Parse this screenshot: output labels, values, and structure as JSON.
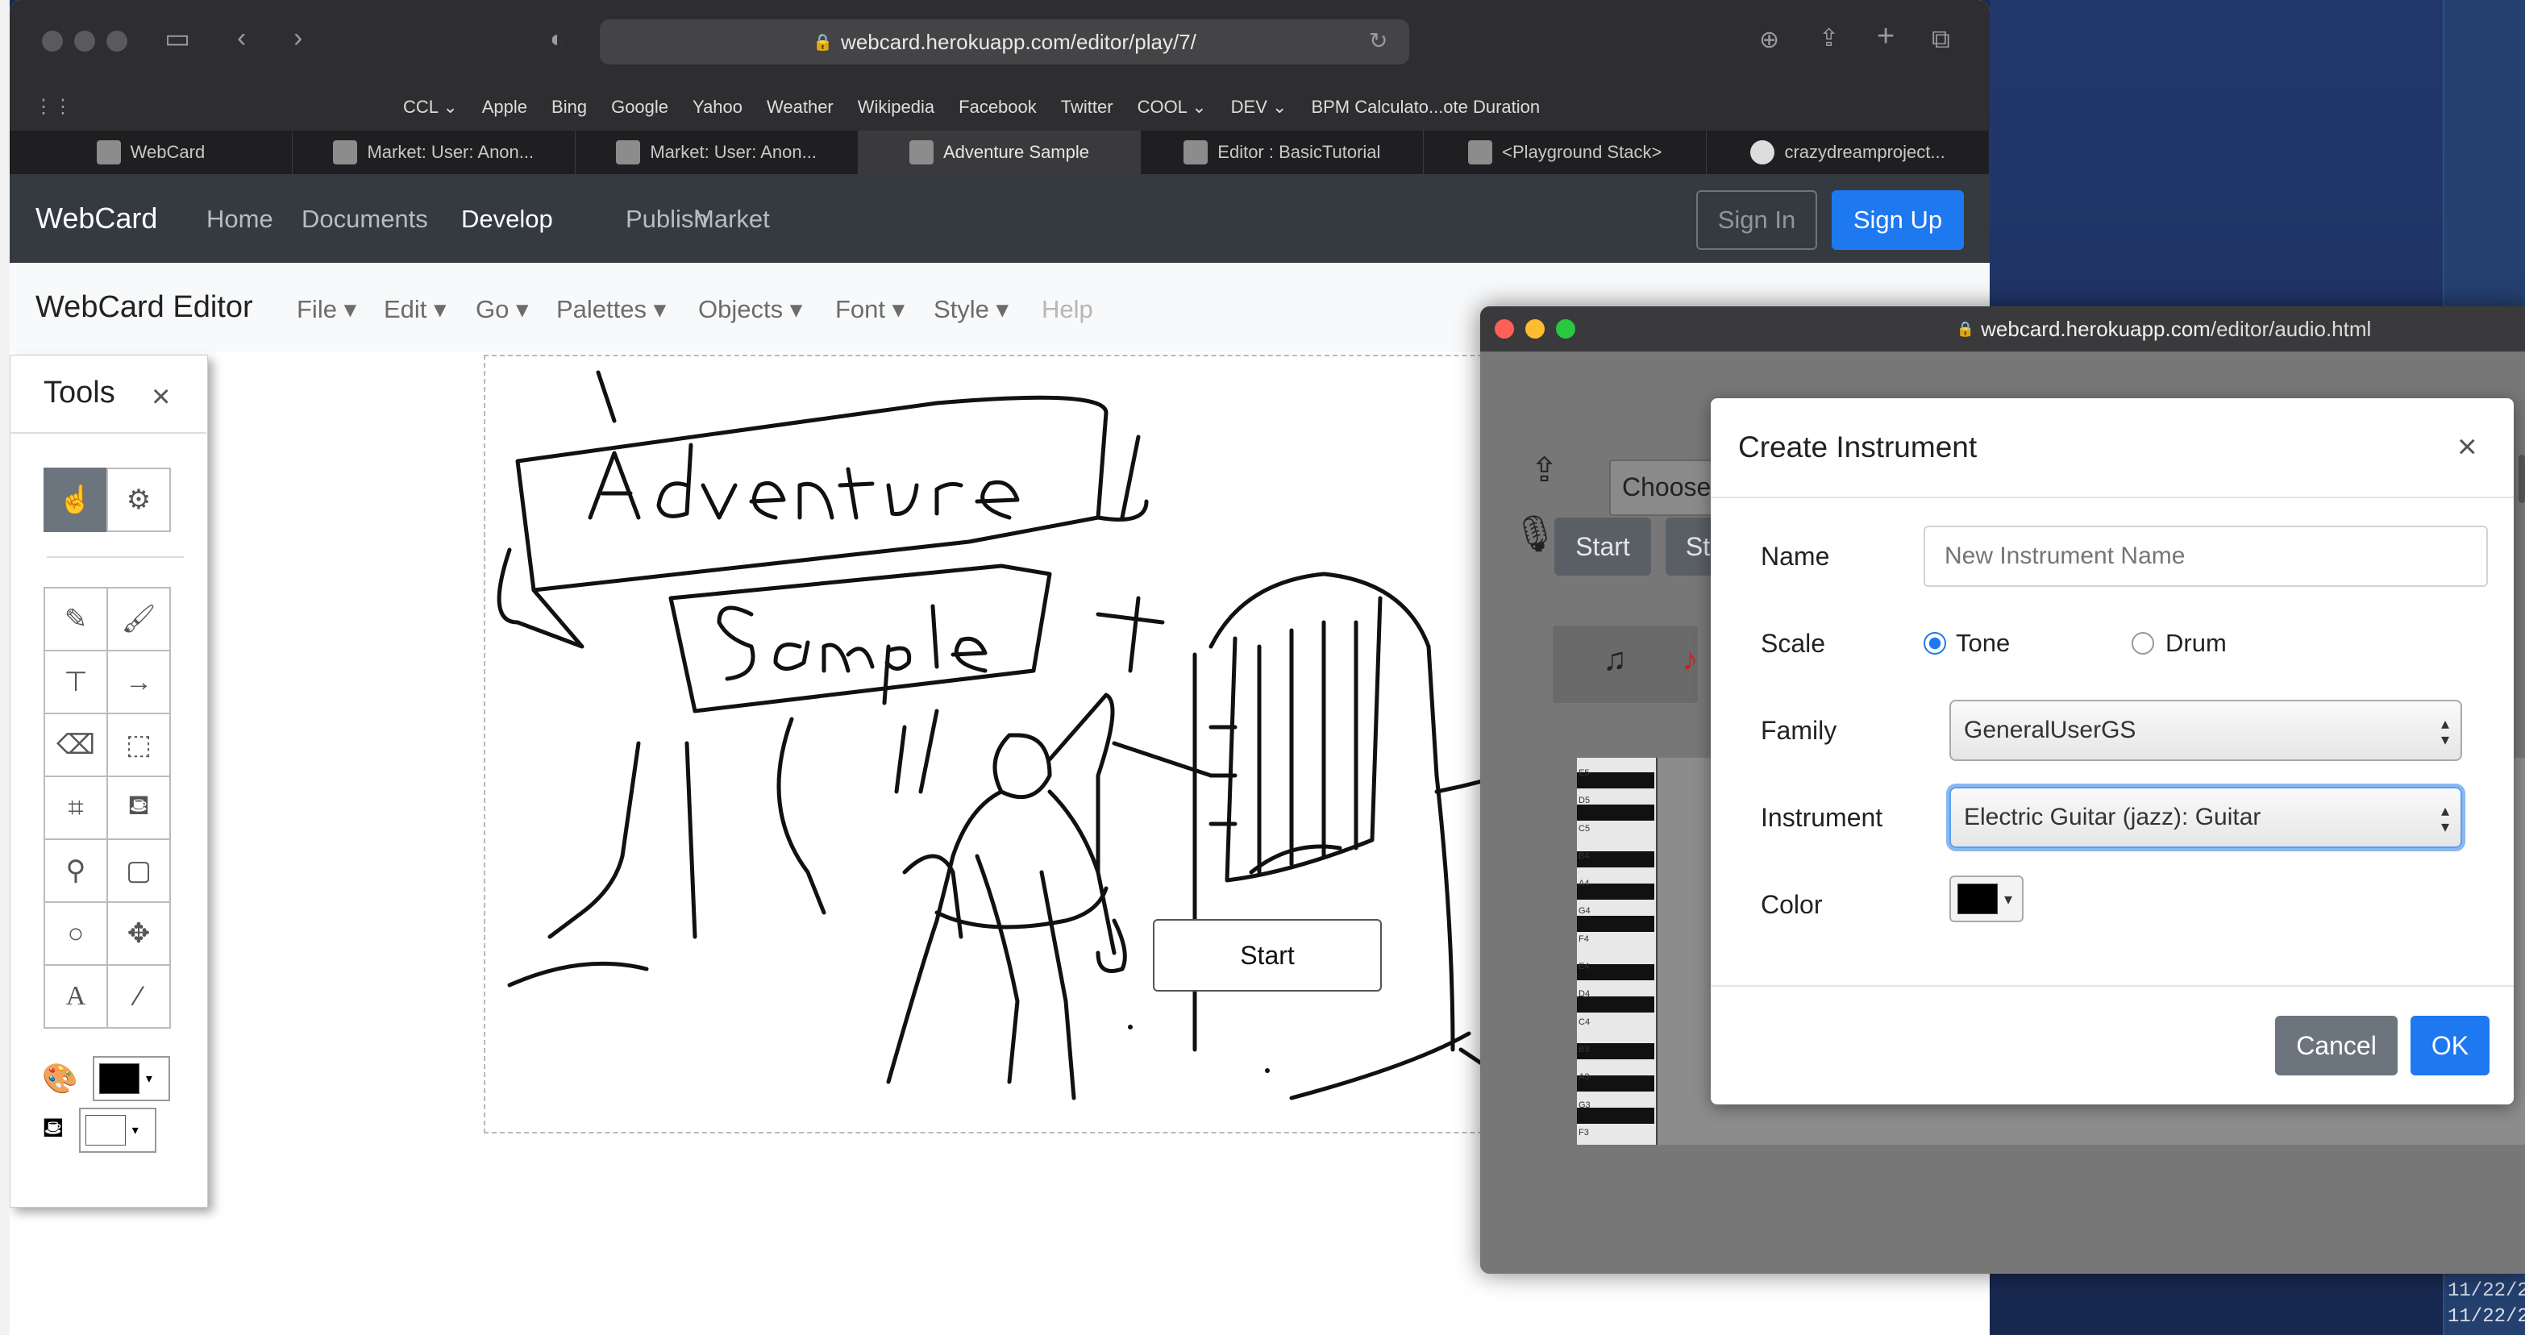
{
  "browser": {
    "url": "webcard.herokuapp.com/editor/play/7/",
    "favorites": [
      "CCL",
      "Apple",
      "Bing",
      "Google",
      "Yahoo",
      "Weather",
      "Wikipedia",
      "Facebook",
      "Twitter",
      "COOL",
      "DEV",
      "BPM Calculato...ote Duration"
    ],
    "favorites_dropdown": [
      true,
      false,
      false,
      false,
      false,
      false,
      false,
      false,
      false,
      true,
      true,
      false
    ],
    "tabs": [
      "WebCard",
      "Market: User: Anon...",
      "Market: User: Anon...",
      "Adventure Sample",
      "Editor : BasicTutorial",
      "<Playground Stack>",
      "crazydreamproject..."
    ],
    "active_tab": 3
  },
  "site": {
    "brand": "WebCard",
    "nav": [
      "Home",
      "Documents",
      "Develop",
      "Publish",
      "Market"
    ],
    "active_nav": "Develop",
    "sign_in": "Sign In",
    "sign_up": "Sign Up"
  },
  "editor": {
    "title": "WebCard Editor",
    "menus": [
      "File",
      "Edit",
      "Go",
      "Palettes",
      "Objects",
      "Font",
      "Style"
    ],
    "help": "Help"
  },
  "canvas": {
    "start_button": "Start"
  },
  "tools": {
    "title": "Tools",
    "close": "×"
  },
  "audio_window": {
    "url_host": "webcard.herokuapp.com",
    "url_path": "/editor/audio.html",
    "choose_label": "Choose",
    "start_label": "Start",
    "stop_partial": "St",
    "piano_labels": [
      "E5",
      "D5",
      "C5",
      "B4",
      "A4",
      "G4",
      "F4",
      "E4",
      "D4",
      "C4",
      "B3",
      "A3",
      "G3",
      "F3"
    ]
  },
  "modal": {
    "title": "Create Instrument",
    "close": "×",
    "name_label": "Name",
    "name_value": "New Instrument Name",
    "scale_label": "Scale",
    "scale_options": [
      "Tone",
      "Drum"
    ],
    "scale_selected": "Tone",
    "family_label": "Family",
    "family_value": "GeneralUserGS",
    "instrument_label": "Instrument",
    "instrument_value": "Electric Guitar (jazz): Guitar",
    "color_label": "Color",
    "color_value": "#000000",
    "cancel": "Cancel",
    "ok": "OK"
  },
  "desktop": {
    "clock_lines": [
      "11/22/2",
      "11/22/2"
    ]
  },
  "colors": {
    "accent": "#1e78f0",
    "navbar": "#343a40",
    "secondary": "#6c757d"
  }
}
